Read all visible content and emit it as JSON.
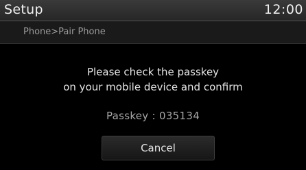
{
  "header": {
    "title": "Setup",
    "clock": "12:00"
  },
  "breadcrumb": "Phone>Pair Phone",
  "dialog": {
    "message_line1": "Please check the passkey",
    "message_line2": "on your mobile device and confirm",
    "passkey_text": "Passkey : 035134",
    "cancel_label": "Cancel"
  }
}
